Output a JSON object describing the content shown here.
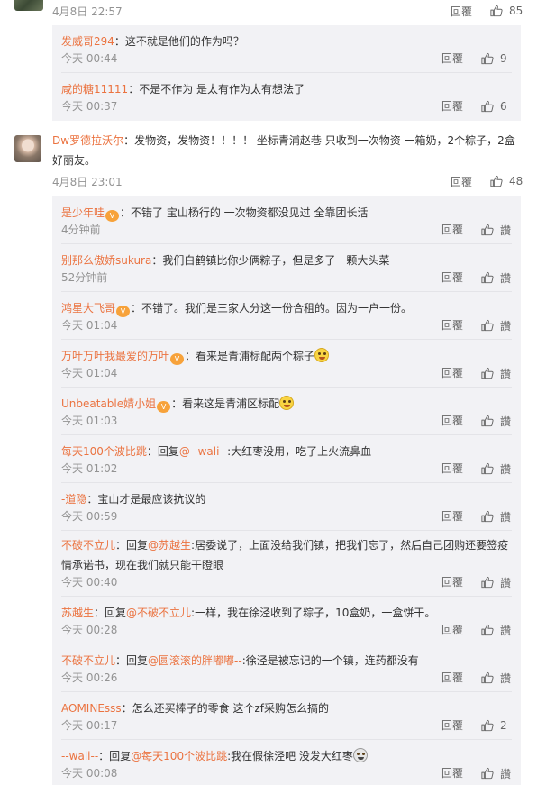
{
  "top": {
    "time": "4月8日 22:57",
    "reply": "回覆",
    "likes": "85"
  },
  "block1": [
    {
      "name": "发威哥294",
      "text": "：这不就是他们的作为吗？",
      "time": "今天 00:44",
      "reply": "回覆",
      "likes": "9"
    },
    {
      "name": "咸的糖11111",
      "text": "：不是不作为 是太有作为太有想法了",
      "time": "今天 00:37",
      "reply": "回覆",
      "likes": "6"
    }
  ],
  "main": {
    "name": "Dw罗德拉沃尔",
    "text": "：发物资，发物资！！！！ 坐标青浦赵巷 只收到一次物资 一箱奶，2个粽子，2盒好丽友。",
    "time": "4月8日 23:01",
    "reply": "回覆",
    "likes": "48"
  },
  "block2": [
    {
      "name": "是少年哇",
      "text": "：不错了 宝山杨行的 一次物资都没见过 全靠团长活",
      "time": "4分钟前",
      "reply": "回覆",
      "likes": "讚"
    },
    {
      "name": "别那么傲娇sukura",
      "text": "：我们白鹤镇比你少俩粽子，但是多了一颗大头菜",
      "time": "52分钟前",
      "reply": "回覆",
      "likes": "讚"
    },
    {
      "name": "鸿星大飞哥",
      "text": "：不错了。我们是三家人分这一份合租的。因为一户一份。",
      "time": "今天 01:04",
      "reply": "回覆",
      "likes": "讚"
    },
    {
      "name": "万叶万叶我最爱的万叶",
      "text": "：看来是青浦标配两个粽子",
      "time": "今天 01:04",
      "reply": "回覆",
      "likes": "讚"
    },
    {
      "name": "Unbeatable婧小姐",
      "text": "：看来这是青浦区标配",
      "time": "今天 01:03",
      "reply": "回覆",
      "likes": "讚"
    },
    {
      "name": "每天100个波比跳",
      "pre": "：回复",
      "at": "@--wali--",
      "text": ":大红枣没用，吃了上火流鼻血",
      "time": "今天 01:02",
      "reply": "回覆",
      "likes": "讚"
    },
    {
      "name": "-道隐",
      "text": "：宝山才是最应该抗议的",
      "time": "今天 00:59",
      "reply": "回覆",
      "likes": "讚"
    },
    {
      "name": "不破不立儿",
      "pre": "：回复",
      "at": "@苏越生",
      "text": ":居委说了，上面没给我们镇，把我们忘了，然后自己团购还要签疫情承诺书，现在我们就只能干瞪眼",
      "time": "今天 00:40",
      "reply": "回覆",
      "likes": "讚"
    },
    {
      "name": "苏越生",
      "pre": "：回复",
      "at": "@不破不立儿",
      "text": ":一样，我在徐泾收到了粽子，10盒奶，一盒饼干。",
      "time": "今天 00:28",
      "reply": "回覆",
      "likes": "讚"
    },
    {
      "name": "不破不立儿",
      "pre": "：回复",
      "at": "@圆滚滚的胖嘟嘟--",
      "text": ":徐泾是被忘记的一个镇，连药都没有",
      "time": "今天 00:26",
      "reply": "回覆",
      "likes": "讚"
    },
    {
      "name": "AOMINEsss",
      "text": "：怎么还买棒子的零食 这个zf采购怎么搞的",
      "time": "今天 00:17",
      "reply": "回覆",
      "likes": "2"
    },
    {
      "name": "--wali--",
      "pre": "：回复",
      "at": "@每天100个波比跳",
      "text": ":我在假徐泾吧 没发大红枣",
      "time": "今天 00:08",
      "reply": "回覆",
      "likes": "讚"
    }
  ]
}
